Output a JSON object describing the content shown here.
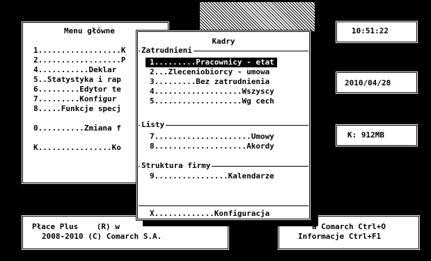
{
  "main_menu": {
    "title": "Menu główne",
    "items": [
      "1..................K",
      "2..................P",
      "4...........Deklar",
      "5..Statystyka i rap",
      "6.........Edytor te",
      "7.........Konfigur",
      "8.....Funkcje specj",
      "",
      "0..........Zmiana f",
      "",
      "K................Ko"
    ]
  },
  "kadry_menu": {
    "title": "Kadry",
    "sections": [
      {
        "label": "Zatrudnieni",
        "items": [
          "1.........Pracownicy - etat",
          "2...Zleceniobiorcy - umowa",
          "3.........Bez zatrudnienia",
          "4...................Wszyscy",
          "5...................Wg cech"
        ]
      },
      {
        "label": "Listy",
        "items": [
          "7.....................Umowy",
          "8....................Akordy"
        ]
      },
      {
        "label": "Struktura firmy",
        "items": [
          "9................Kalendarze"
        ]
      },
      {
        "label": "",
        "items": [
          "X.............Konfiguracja"
        ]
      }
    ],
    "selected_index": 0
  },
  "status": {
    "time": "10:51:22",
    "date": "2010/04/28",
    "memory": "K: 912MB"
  },
  "footer_left": {
    "line1": "Płace Plus    (R) w",
    "line2": "2008-2010 (C) Comarch S.A."
  },
  "footer_right": {
    "line1": "a Comarch Ctrl+O",
    "line2": "Informacje Ctrl+F1"
  },
  "colors": {
    "background": "#000000",
    "window": "#ffffff",
    "highlight": "#000000"
  }
}
